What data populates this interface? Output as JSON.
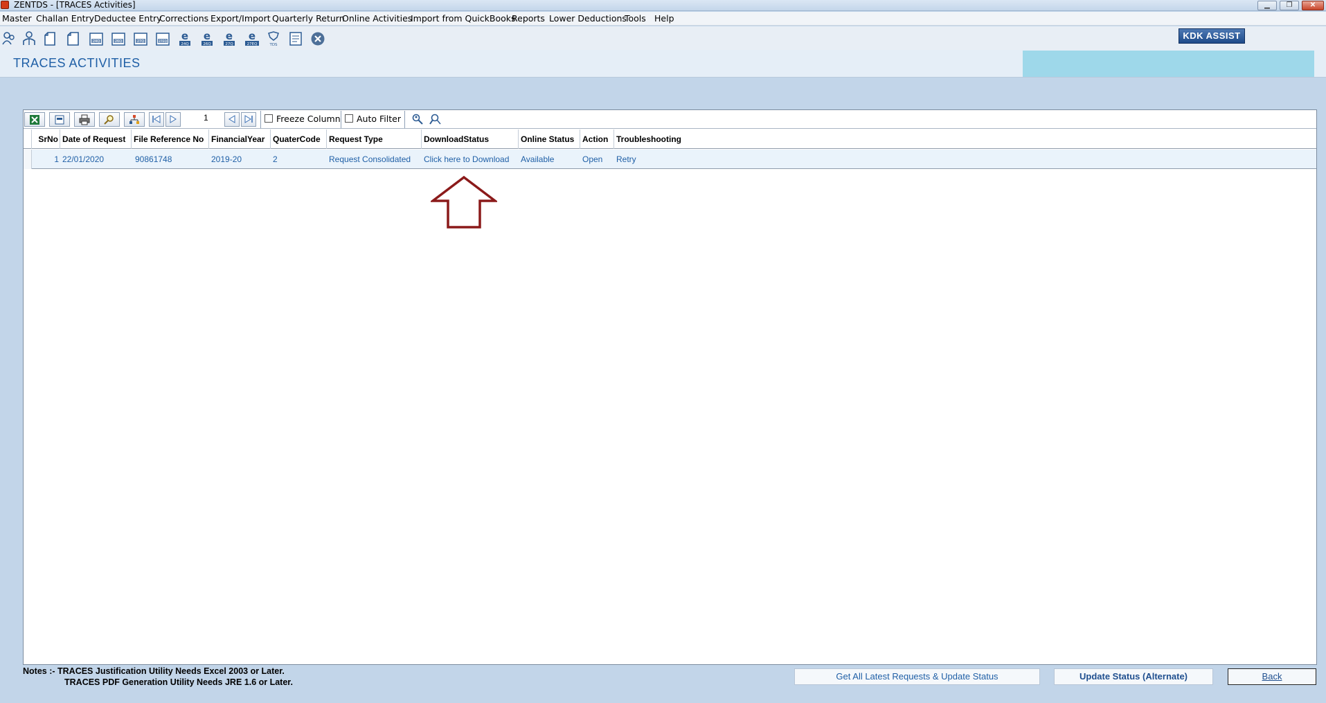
{
  "window": {
    "title": "ZENTDS - [TRACES Activities]"
  },
  "menu": [
    "Master",
    "Challan Entry",
    "Deductee Entry",
    "Corrections",
    "Export/Import",
    "Quarterly Return",
    "Online Activities",
    "Import from QuickBooks",
    "Reports",
    "Lower Deductions",
    "Tools",
    "Help"
  ],
  "toolbar": {
    "icons": [
      "deductor-icon",
      "employee-icon",
      "form-icon",
      "form-icon-2",
      "form-24q-icon",
      "form-26q-icon",
      "form-27q-icon",
      "form-27eq-icon",
      "e-24q-icon",
      "e-26q-icon",
      "e-27q-icon",
      "e-27eq-icon",
      "tds-icon",
      "report-icon",
      "close-icon"
    ],
    "icon_labels": [
      "",
      "",
      "",
      "",
      "24Q",
      "26Q",
      "27Q",
      "27EQ",
      "24Q",
      "26Q",
      "27Q",
      "27EQ",
      "TDS",
      "",
      ""
    ],
    "kdk_assist": "KDK ASSIST"
  },
  "page": {
    "title": "TRACES ACTIVITIES"
  },
  "grid": {
    "page_number": "1",
    "freeze_column": "Freeze Column",
    "auto_filter": "Auto Filter",
    "columns": [
      "SrNo",
      "Date of Request",
      "File Reference No",
      "FinancialYear",
      "QuaterCode",
      "Request Type",
      "DownloadStatus",
      "Online Status",
      "Action",
      "Troubleshooting"
    ],
    "rows": [
      {
        "srno": "1",
        "date": "22/01/2020",
        "file_ref": "90861748",
        "fy": "2019-20",
        "quarter": "2",
        "request_type": "Request Consolidated",
        "download_status": "Click here to Download",
        "online_status": "Available",
        "action": "Open",
        "troubleshooting": "Retry"
      }
    ]
  },
  "footer": {
    "note_line1": "Notes :- TRACES Justification Utility Needs Excel 2003 or Later.",
    "note_line2": "TRACES PDF Generation Utility Needs JRE 1.6 or Later.",
    "get_latest": "Get All Latest Requests & Update Status",
    "update_alt": "Update Status (Alternate)",
    "back": "Back"
  },
  "colors": {
    "accent": "#1f5fa6",
    "arrow": "#8b1a1a",
    "background": "#c2d5e9"
  }
}
